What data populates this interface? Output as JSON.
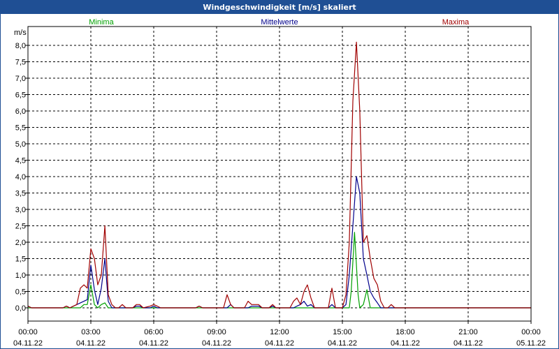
{
  "window": {
    "title": "Windgeschwindigkeit [m/s] skaliert"
  },
  "chart_data": {
    "type": "line",
    "title": "Windgeschwindigkeit [m/s] skaliert",
    "ylabel": "m/s",
    "ylim": [
      0,
      8.5
    ],
    "yticks": [
      "0,0",
      "0,5",
      "1,0",
      "1,5",
      "2,0",
      "2,5",
      "3,0",
      "3,5",
      "4,0",
      "4,5",
      "5,0",
      "5,5",
      "6,0",
      "6,5",
      "7,0",
      "7,5",
      "8,0"
    ],
    "xlim": [
      0,
      24
    ],
    "xticks": [
      {
        "time": "00:00",
        "date": "04.11.22",
        "h": 0
      },
      {
        "time": "03:00",
        "date": "04.11.22",
        "h": 3
      },
      {
        "time": "06:00",
        "date": "04.11.22",
        "h": 6
      },
      {
        "time": "09:00",
        "date": "04.11.22",
        "h": 9
      },
      {
        "time": "12:00",
        "date": "04.11.22",
        "h": 12
      },
      {
        "time": "15:00",
        "date": "04.11.22",
        "h": 15
      },
      {
        "time": "18:00",
        "date": "04.11.22",
        "h": 18
      },
      {
        "time": "21:00",
        "date": "04.11.22",
        "h": 21
      },
      {
        "time": "00:00",
        "date": "05.11.22",
        "h": 24
      }
    ],
    "grid": true,
    "series": [
      {
        "name": "Minima",
        "color": "#00a000",
        "points": [
          [
            0,
            0
          ],
          [
            2.5,
            0
          ],
          [
            2.67,
            0.1
          ],
          [
            2.83,
            0.1
          ],
          [
            3.0,
            0.7
          ],
          [
            3.17,
            0.1
          ],
          [
            3.33,
            0
          ],
          [
            3.5,
            0.1
          ],
          [
            3.67,
            0.15
          ],
          [
            3.83,
            0
          ],
          [
            15.33,
            0
          ],
          [
            15.42,
            0.5
          ],
          [
            15.58,
            2.3
          ],
          [
            15.75,
            0.4
          ],
          [
            15.83,
            0
          ],
          [
            16.0,
            0.1
          ],
          [
            16.17,
            0.55
          ],
          [
            16.33,
            0
          ],
          [
            24,
            0
          ]
        ]
      },
      {
        "name": "Mittelwerte",
        "color": "#00008b",
        "points": [
          [
            0,
            0.05
          ],
          [
            0.17,
            0
          ],
          [
            1.67,
            0
          ],
          [
            1.83,
            0.05
          ],
          [
            2.0,
            0
          ],
          [
            2.5,
            0.15
          ],
          [
            2.67,
            0.2
          ],
          [
            2.83,
            0.25
          ],
          [
            3.0,
            1.3
          ],
          [
            3.17,
            0.55
          ],
          [
            3.33,
            0.1
          ],
          [
            3.5,
            0.6
          ],
          [
            3.67,
            1.5
          ],
          [
            3.83,
            0.2
          ],
          [
            4.0,
            0
          ],
          [
            5.0,
            0
          ],
          [
            5.17,
            0.05
          ],
          [
            5.33,
            0.05
          ],
          [
            5.5,
            0
          ],
          [
            5.83,
            0
          ],
          [
            6.0,
            0.05
          ],
          [
            6.17,
            0
          ],
          [
            8.0,
            0
          ],
          [
            8.17,
            0.05
          ],
          [
            8.33,
            0
          ],
          [
            9.5,
            0
          ],
          [
            9.67,
            0.1
          ],
          [
            9.83,
            0
          ],
          [
            10.5,
            0
          ],
          [
            10.67,
            0.05
          ],
          [
            11.0,
            0.05
          ],
          [
            11.17,
            0
          ],
          [
            11.5,
            0
          ],
          [
            11.67,
            0.05
          ],
          [
            11.83,
            0
          ],
          [
            12.67,
            0
          ],
          [
            12.83,
            0.05
          ],
          [
            13.0,
            0.1
          ],
          [
            13.17,
            0.2
          ],
          [
            13.33,
            0.05
          ],
          [
            13.5,
            0.1
          ],
          [
            13.67,
            0
          ],
          [
            14.33,
            0
          ],
          [
            14.5,
            0.1
          ],
          [
            14.67,
            0
          ],
          [
            15.0,
            0
          ],
          [
            15.17,
            0.1
          ],
          [
            15.33,
            1.0
          ],
          [
            15.5,
            2.5
          ],
          [
            15.67,
            4.0
          ],
          [
            15.83,
            3.5
          ],
          [
            16.0,
            1.5
          ],
          [
            16.17,
            1.0
          ],
          [
            16.33,
            0.5
          ],
          [
            16.5,
            0.3
          ],
          [
            16.67,
            0.15
          ],
          [
            16.83,
            0
          ],
          [
            24,
            0
          ]
        ]
      },
      {
        "name": "Maxima",
        "color": "#a00000",
        "points": [
          [
            0,
            0.05
          ],
          [
            0.17,
            0
          ],
          [
            1.67,
            0
          ],
          [
            1.83,
            0.05
          ],
          [
            2.0,
            0
          ],
          [
            2.33,
            0.1
          ],
          [
            2.5,
            0.6
          ],
          [
            2.67,
            0.7
          ],
          [
            2.83,
            0.6
          ],
          [
            3.0,
            1.8
          ],
          [
            3.17,
            1.5
          ],
          [
            3.33,
            0.7
          ],
          [
            3.5,
            1.0
          ],
          [
            3.67,
            2.5
          ],
          [
            3.83,
            0.4
          ],
          [
            4.0,
            0.1
          ],
          [
            4.17,
            0
          ],
          [
            4.33,
            0
          ],
          [
            4.5,
            0.1
          ],
          [
            4.67,
            0
          ],
          [
            5.0,
            0
          ],
          [
            5.17,
            0.1
          ],
          [
            5.33,
            0.1
          ],
          [
            5.5,
            0
          ],
          [
            5.83,
            0.05
          ],
          [
            6.0,
            0.1
          ],
          [
            6.17,
            0.05
          ],
          [
            6.33,
            0
          ],
          [
            8.0,
            0
          ],
          [
            8.17,
            0.05
          ],
          [
            8.33,
            0
          ],
          [
            9.33,
            0
          ],
          [
            9.5,
            0.4
          ],
          [
            9.67,
            0.1
          ],
          [
            9.83,
            0
          ],
          [
            10.33,
            0
          ],
          [
            10.5,
            0.2
          ],
          [
            10.67,
            0.1
          ],
          [
            11.0,
            0.1
          ],
          [
            11.17,
            0
          ],
          [
            11.5,
            0
          ],
          [
            11.67,
            0.1
          ],
          [
            11.83,
            0
          ],
          [
            12.5,
            0
          ],
          [
            12.67,
            0.2
          ],
          [
            12.83,
            0.3
          ],
          [
            13.0,
            0.1
          ],
          [
            13.17,
            0.5
          ],
          [
            13.33,
            0.7
          ],
          [
            13.5,
            0.3
          ],
          [
            13.67,
            0
          ],
          [
            14.33,
            0
          ],
          [
            14.5,
            0.6
          ],
          [
            14.67,
            0
          ],
          [
            15.0,
            0
          ],
          [
            15.17,
            0.4
          ],
          [
            15.33,
            2.0
          ],
          [
            15.5,
            6.3
          ],
          [
            15.67,
            8.1
          ],
          [
            15.83,
            6.0
          ],
          [
            16.0,
            2.0
          ],
          [
            16.17,
            2.2
          ],
          [
            16.33,
            1.5
          ],
          [
            16.5,
            0.9
          ],
          [
            16.67,
            0.7
          ],
          [
            16.83,
            0.2
          ],
          [
            17.0,
            0
          ],
          [
            17.17,
            0
          ],
          [
            17.33,
            0.1
          ],
          [
            17.5,
            0
          ],
          [
            24,
            0
          ]
        ]
      }
    ]
  }
}
